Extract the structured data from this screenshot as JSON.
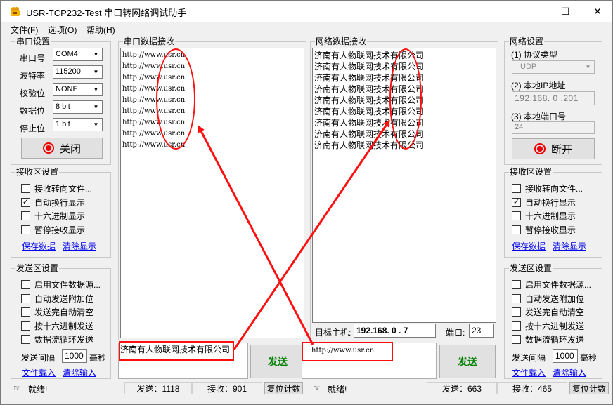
{
  "window": {
    "title": "USR-TCP232-Test 串口转网络调试助手",
    "minimize": "—",
    "maximize": "☐",
    "close": "✕"
  },
  "menu": [
    "文件(F)",
    "选项(O)",
    "帮助(H)"
  ],
  "serial_settings": {
    "title": "串口设置",
    "port_label": "串口号",
    "port_value": "COM4",
    "baud_label": "波特率",
    "baud_value": "115200",
    "parity_label": "校验位",
    "parity_value": "NONE",
    "databits_label": "数据位",
    "databits_value": "8 bit",
    "stopbits_label": "停止位",
    "stopbits_value": "1 bit",
    "close_button": "关闭"
  },
  "left_recv_settings": {
    "title": "接收区设置",
    "options": [
      {
        "label": "接收转向文件...",
        "checked": false
      },
      {
        "label": "自动换行显示",
        "checked": true
      },
      {
        "label": "十六进制显示",
        "checked": false
      },
      {
        "label": "暂停接收显示",
        "checked": false
      }
    ],
    "save_link": "保存数据",
    "clear_link": "清除显示"
  },
  "left_send_settings": {
    "title": "发送区设置",
    "options": [
      {
        "label": "启用文件数据源...",
        "checked": false
      },
      {
        "label": "自动发送附加位",
        "checked": false
      },
      {
        "label": "发送完自动清空",
        "checked": false
      },
      {
        "label": "按十六进制发送",
        "checked": false
      },
      {
        "label": "数据流循环发送",
        "checked": false
      }
    ],
    "interval_label": "发送间隔",
    "interval_value": "1000",
    "interval_unit": "毫秒",
    "load_link": "文件载入",
    "clear_link": "清除输入"
  },
  "serial_recv": {
    "title": "串口数据接收",
    "lines": [
      "http://www.usr.cn",
      "http://www.usr.cn",
      "http://www.usr.cn",
      "http://www.usr.cn",
      "http://www.usr.cn",
      "http://www.usr.cn",
      "http://www.usr.cn",
      "http://www.usr.cn",
      "http://www.usr.cn"
    ]
  },
  "net_recv": {
    "title": "网络数据接收",
    "lines": [
      "济南有人物联网技术有限公司",
      "济南有人物联网技术有限公司",
      "济南有人物联网技术有限公司",
      "济南有人物联网技术有限公司",
      "济南有人物联网技术有限公司",
      "济南有人物联网技术有限公司",
      "济南有人物联网技术有限公司",
      "济南有人物联网技术有限公司",
      "济南有人物联网技术有限公司"
    ]
  },
  "target": {
    "host_label": "目标主机:",
    "host_value": "192.168. 0 . 7",
    "port_label": "端口:",
    "port_value": "23"
  },
  "serial_send": {
    "text": "济南有人物联网技术有限公司",
    "button": "发送"
  },
  "net_send": {
    "text": "http://www.usr.cn",
    "button": "发送"
  },
  "net_settings": {
    "title": "网络设置",
    "protocol_label": "(1) 协议类型",
    "protocol_value": "UDP",
    "ip_label": "(2) 本地IP地址",
    "ip_value": "192.168. 0 .201",
    "port_label": "(3) 本地端口号",
    "port_value": "24",
    "open_button": "断开"
  },
  "right_recv_settings": {
    "title": "接收区设置",
    "options": [
      {
        "label": "接收转向文件...",
        "checked": false
      },
      {
        "label": "自动换行显示",
        "checked": true
      },
      {
        "label": "十六进制显示",
        "checked": false
      },
      {
        "label": "暂停接收显示",
        "checked": false
      }
    ],
    "save_link": "保存数据",
    "clear_link": "清除显示"
  },
  "right_send_settings": {
    "title": "发送区设置",
    "options": [
      {
        "label": "启用文件数据源...",
        "checked": false
      },
      {
        "label": "自动发送附加位",
        "checked": false
      },
      {
        "label": "发送完自动清空",
        "checked": false
      },
      {
        "label": "按十六进制发送",
        "checked": false
      },
      {
        "label": "数据流循环发送",
        "checked": false
      }
    ],
    "interval_label": "发送间隔",
    "interval_value": "1000",
    "interval_unit": "毫秒",
    "load_link": "文件载入",
    "clear_link": "清除输入"
  },
  "status_left": {
    "ready": "就绪!",
    "sent": "发送：1118",
    "received": "接收：901",
    "reset": "复位计数"
  },
  "status_right": {
    "ready": "就绪!",
    "sent": "发送：663",
    "received": "接收：465",
    "reset": "复位计数"
  },
  "annotation_color": "#ff1010"
}
